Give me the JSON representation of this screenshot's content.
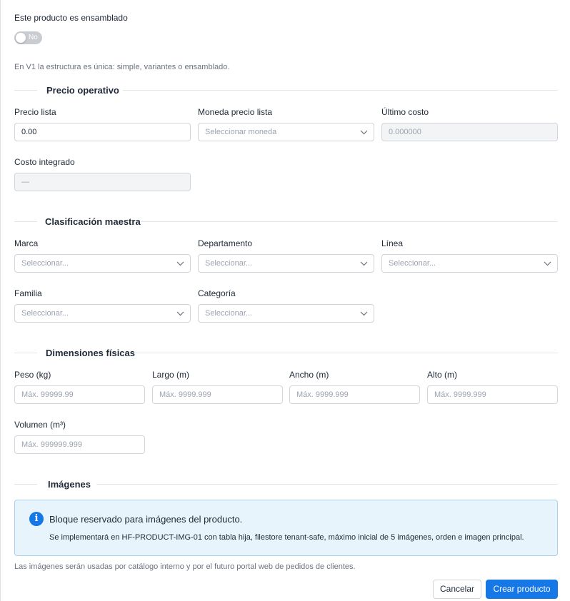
{
  "assembled": {
    "label": "Este producto es ensamblado",
    "toggle_text": "No",
    "help": "En V1 la estructura es única: simple, variantes o ensamblado."
  },
  "sections": {
    "price": "Precio operativo",
    "classification": "Clasificación maestra",
    "dimensions": "Dimensiones físicas",
    "images": "Imágenes"
  },
  "price": {
    "list_price_label": "Precio lista",
    "list_price_value": "0.00",
    "currency_label": "Moneda precio lista",
    "currency_placeholder": "Seleccionar moneda",
    "last_cost_label": "Último costo",
    "last_cost_value": "0.000000",
    "integrated_cost_label": "Costo integrado",
    "integrated_cost_value": "—"
  },
  "classification": {
    "brand_label": "Marca",
    "brand_placeholder": "Seleccionar...",
    "department_label": "Departamento",
    "department_placeholder": "Seleccionar...",
    "line_label": "Línea",
    "line_placeholder": "Seleccionar...",
    "family_label": "Familia",
    "family_placeholder": "Seleccionar...",
    "category_label": "Categoría",
    "category_placeholder": "Seleccionar..."
  },
  "dimensions": {
    "weight_label": "Peso (kg)",
    "weight_placeholder": "Máx. 99999.99",
    "length_label": "Largo (m)",
    "length_placeholder": "Máx. 9999.999",
    "width_label": "Ancho (m)",
    "width_placeholder": "Máx. 9999.999",
    "height_label": "Alto (m)",
    "height_placeholder": "Máx. 9999.999",
    "volume_label": "Volumen (m³)",
    "volume_placeholder": "Máx. 999999.999"
  },
  "images": {
    "info_title": "Bloque reservado para imágenes del producto.",
    "info_body": "Se implementará en HF-PRODUCT-IMG-01 con tabla hija, filestore tenant-safe, máximo inicial de 5 imágenes, orden e imagen principal.",
    "note": "Las imágenes serán usadas por catálogo interno y por el futuro portal web de pedidos de clientes."
  },
  "actions": {
    "cancel": "Cancelar",
    "create": "Crear producto"
  },
  "colors": {
    "primary": "#1677e6",
    "info_bg": "#e8f4fc",
    "info_border": "#a8d1ef"
  }
}
